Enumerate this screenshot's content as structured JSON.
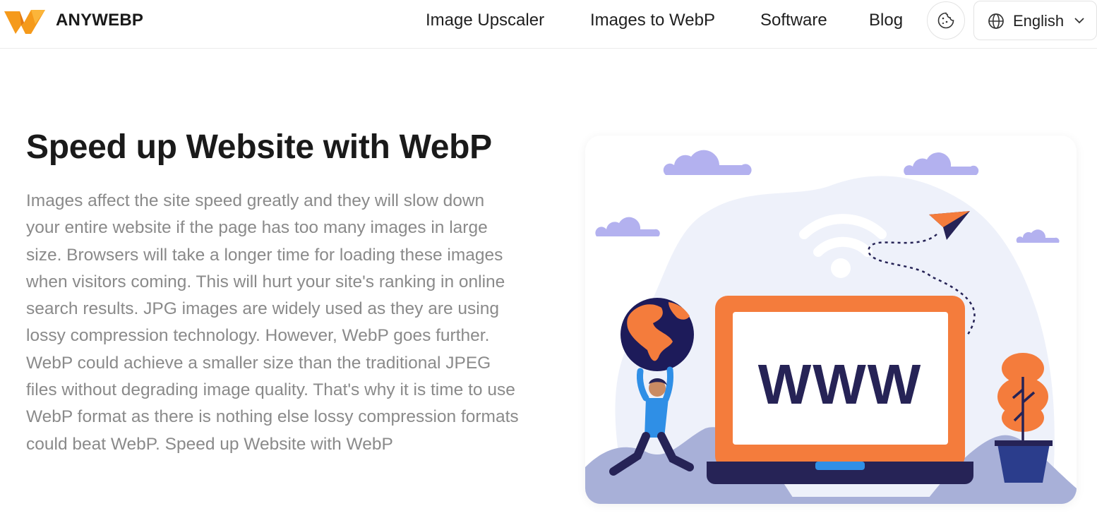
{
  "header": {
    "brand": "ANYWEBP",
    "nav": [
      {
        "label": "Image Upscaler"
      },
      {
        "label": "Images to WebP"
      },
      {
        "label": "Software"
      },
      {
        "label": "Blog"
      }
    ],
    "theme_icon": "cookie-theme-icon",
    "language": {
      "label": "English",
      "icon": "globe-icon",
      "chevron": "chevron-down-icon"
    }
  },
  "main": {
    "title": "Speed up Website with WebP",
    "body": "Images affect the site speed greatly and they will slow down your entire website if the page has too many images in large size. Browsers will take a longer time for loading these images when visitors coming. This will hurt your site's ranking in online search results. JPG images are widely used as they are using lossy compression technology. However, WebP goes further. WebP could achieve a smaller size than the traditional JPEG files without degrading image quality. That's why it is time to use WebP format as there is nothing else lossy compression formats could beat WebP. Speed up Website with WebP",
    "illustration": {
      "screen_text": "WWW",
      "colors": {
        "laptop": "#f47c3c",
        "cloud": "#b3b1ef",
        "navy": "#262356",
        "blob": "#eef1fa"
      }
    }
  },
  "colors": {
    "logo_orange": "#f59a1b",
    "text_gray": "#8a8a8a",
    "heading": "#1a1a1a"
  }
}
